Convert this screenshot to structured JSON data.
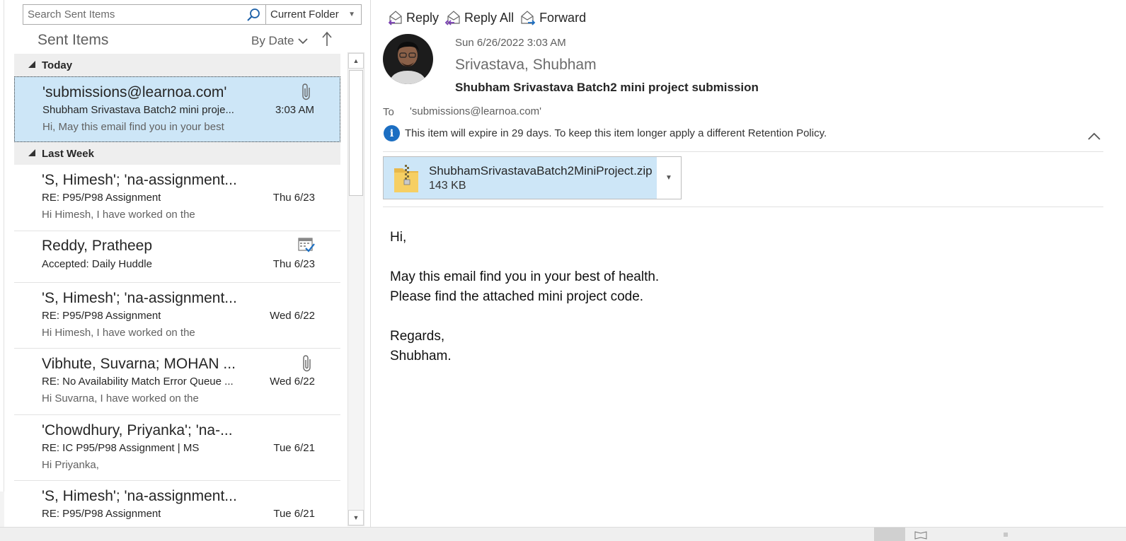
{
  "search": {
    "placeholder": "Search Sent Items",
    "scope": "Current Folder"
  },
  "folder": {
    "title": "Sent Items",
    "sort_by": "By Date"
  },
  "groups": [
    {
      "label": "Today"
    },
    {
      "label": "Last Week"
    }
  ],
  "mails": [
    {
      "from": "'submissions@learnoa.com'",
      "subject": "Shubham Srivastava Batch2 mini proje...",
      "preview": "Hi,  May this email find you in your best",
      "date": "3:03 AM",
      "icon": "paperclip-icon"
    },
    {
      "from": "'S, Himesh'; 'na-assignment...",
      "subject": "RE: P95/P98 Assignment",
      "preview": "Hi Himesh,  I have worked on the",
      "date": "Thu 6/23"
    },
    {
      "from": "Reddy, Pratheep",
      "subject": "Accepted: Daily Huddle",
      "preview": "",
      "date": "Thu 6/23",
      "icon": "meeting-accepted-icon"
    },
    {
      "from": "'S, Himesh'; 'na-assignment...",
      "subject": "RE: P95/P98 Assignment",
      "preview": "Hi Himesh,  I have worked on the",
      "date": "Wed 6/22"
    },
    {
      "from": "Vibhute, Suvarna; MOHAN ...",
      "subject": "RE: No Availability Match Error Queue ...",
      "preview": "Hi Suvarna,  I have worked on the",
      "date": "Wed 6/22",
      "icon": "paperclip-icon"
    },
    {
      "from": "'Chowdhury, Priyanka'; 'na-...",
      "subject": "RE: IC P95/P98 Assignment | MS",
      "preview": "Hi Priyanka,",
      "date": "Tue 6/21"
    },
    {
      "from": "'S, Himesh'; 'na-assignment...",
      "subject": "RE: P95/P98 Assignment",
      "preview": "",
      "date": "Tue 6/21"
    }
  ],
  "reading": {
    "actions": {
      "reply": "Reply",
      "reply_all": "Reply All",
      "forward": "Forward"
    },
    "sent_time": "Sun 6/26/2022 3:03 AM",
    "sender": "Srivastava, Shubham",
    "subject": "Shubham Srivastava Batch2 mini project submission",
    "to_label": "To",
    "to_value": "'submissions@learnoa.com'",
    "retention_notice": "This item will expire in 29 days. To keep this item longer apply a different Retention Policy.",
    "attachment": {
      "name": "ShubhamSrivastavaBatch2MiniProject.zip",
      "size": "143 KB"
    },
    "body": [
      "Hi,",
      "",
      "May this email find you in your best of health.",
      "Please find the attached mini project code.",
      "",
      "Regards,",
      "Shubham."
    ]
  },
  "colors": {
    "selection": "#cde6f7",
    "info_blue": "#1b6ec2",
    "group_header": "#eeeeee"
  }
}
